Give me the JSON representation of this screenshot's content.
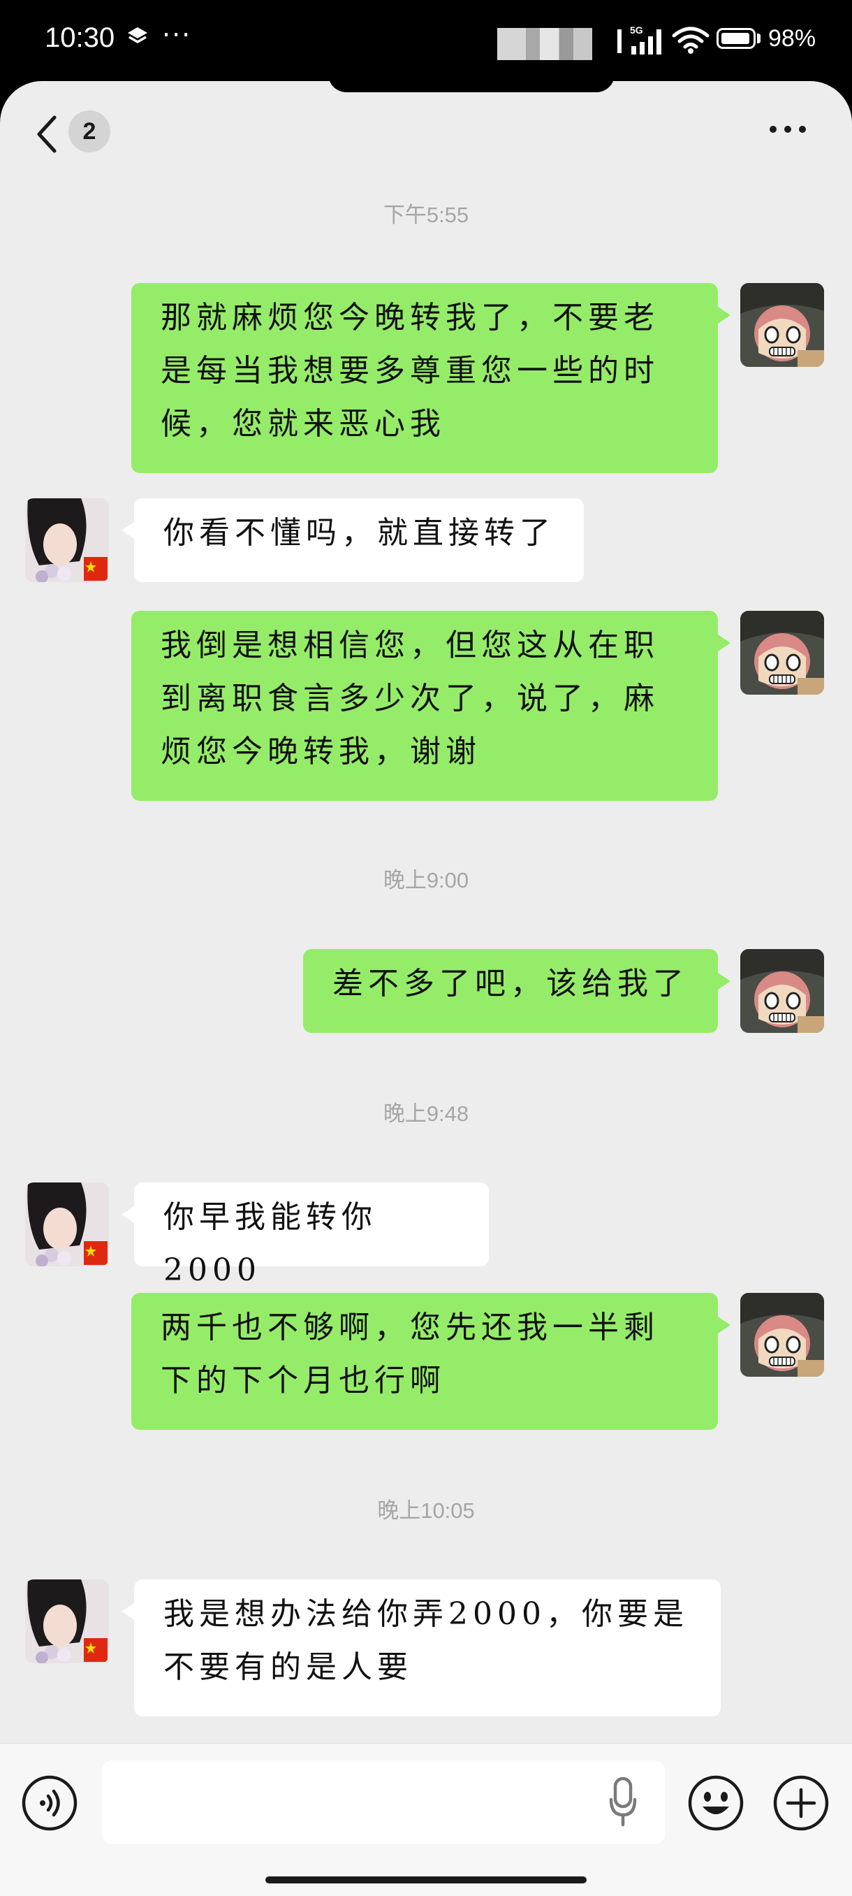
{
  "status_bar": {
    "time": "10:30",
    "dots": "···",
    "network": "5G",
    "battery": "98%"
  },
  "nav": {
    "unread_count": "2"
  },
  "timestamps": {
    "t1": "下午5:55",
    "t2": "晚上9:00",
    "t3": "晚上9:48",
    "t4": "晚上10:05"
  },
  "messages": [
    {
      "from": "me",
      "text": "那就麻烦您今晚转我了，不要老是每当我想要多尊重您一些的时候，您就来恶心我"
    },
    {
      "from": "them",
      "text": "你看不懂吗，就直接转了"
    },
    {
      "from": "me",
      "text": "我倒是想相信您，但您这从在职到离职食言多少次了，说了，麻烦您今晚转我，谢谢"
    },
    {
      "from": "me",
      "text": "差不多了吧，该给我了"
    },
    {
      "from": "them",
      "text": "你早我能转你2000"
    },
    {
      "from": "me",
      "text": "两千也不够啊，您先还我一半剩下的下个月也行啊"
    },
    {
      "from": "them",
      "text": "我是想办法给你弄2000，你要是不要有的是人要"
    }
  ],
  "input": {
    "value": ""
  }
}
